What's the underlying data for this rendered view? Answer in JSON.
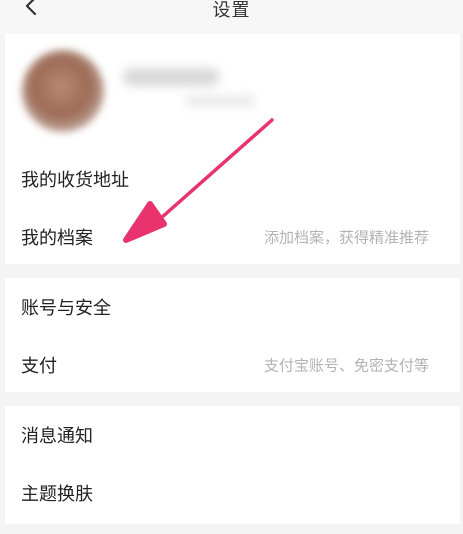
{
  "header": {
    "title": "设置",
    "back_icon": "chevron-left-icon"
  },
  "profile": {
    "avatar": "avatar-blurred",
    "name": "",
    "subtitle": ""
  },
  "groups": [
    {
      "items": [
        {
          "label": "我的收货地址",
          "hint": ""
        },
        {
          "label": "我的档案",
          "hint": "添加档案，获得精准推荐"
        }
      ]
    },
    {
      "items": [
        {
          "label": "账号与安全",
          "hint": ""
        },
        {
          "label": "支付",
          "hint": "支付宝账号、免密支付等"
        }
      ]
    },
    {
      "items": [
        {
          "label": "消息通知",
          "hint": ""
        },
        {
          "label": "主题换肤",
          "hint": ""
        }
      ]
    }
  ],
  "annotation": {
    "arrow_color": "#e8336f",
    "target": "我的档案"
  },
  "colors": {
    "background": "#f4f4f4",
    "card": "#ffffff",
    "hint_text": "#b3b3b3"
  }
}
